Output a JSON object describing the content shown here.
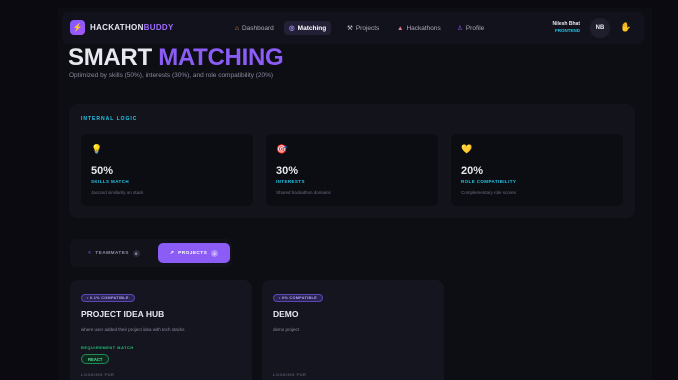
{
  "nav": {
    "brand_primary": "HACKATHON",
    "brand_accent": "BUDDY",
    "items": [
      {
        "icon": "house-icon",
        "glyph": "⌂",
        "label": "Dashboard"
      },
      {
        "icon": "target-icon",
        "glyph": "◎",
        "label": "Matching",
        "active": true
      },
      {
        "icon": "tools-icon",
        "glyph": "⚒",
        "label": "Projects"
      },
      {
        "icon": "flag-icon",
        "glyph": "▲",
        "label": "Hackathons"
      },
      {
        "icon": "person-icon",
        "glyph": "♙",
        "label": "Profile"
      }
    ],
    "user_name": "Nilesh Bhat",
    "user_role": "FRONTEND",
    "avatar_initials": "NB"
  },
  "header": {
    "title_primary": "SMART ",
    "title_accent": "MATCHING",
    "subtitle": "Optimized by skills (50%), interests (30%), and role compatibility (20%)"
  },
  "logic": {
    "heading": "INTERNAL LOGIC",
    "cards": [
      {
        "icon": "lightbulb-icon",
        "pct": "50%",
        "label": "SKILLS MATCH",
        "desc": "Jaccard similarity on stack"
      },
      {
        "icon": "target-icon",
        "pct": "30%",
        "label": "INTERESTS",
        "desc": "Shared hackathon domains"
      },
      {
        "icon": "heart-icon",
        "pct": "20%",
        "label": "ROLE COMPATIBILITY",
        "desc": "Complementary role scores"
      }
    ]
  },
  "tabs": [
    {
      "label": "TEAMMATES",
      "count": "0",
      "active": false
    },
    {
      "label": "PROJECTS",
      "count": "2",
      "active": true
    }
  ],
  "projects": [
    {
      "badge": "• 6.1% COMPATIBLE",
      "name": "PROJECT IDEA HUB",
      "desc": "where user added their project idea with tech stacks",
      "req_label": "REQUIREMENT MATCH",
      "tags": [
        "REACT"
      ],
      "looking_label": "LOOKING FOR"
    },
    {
      "badge": "• 0% COMPATIBLE",
      "name": "DEMO",
      "desc": "demo project",
      "looking_label": "LOOKING FOR"
    }
  ],
  "colors": {
    "accent": "#8b5cf6",
    "cyan": "#22c8e8",
    "green": "#22c87a",
    "background": "#0a0a10"
  }
}
